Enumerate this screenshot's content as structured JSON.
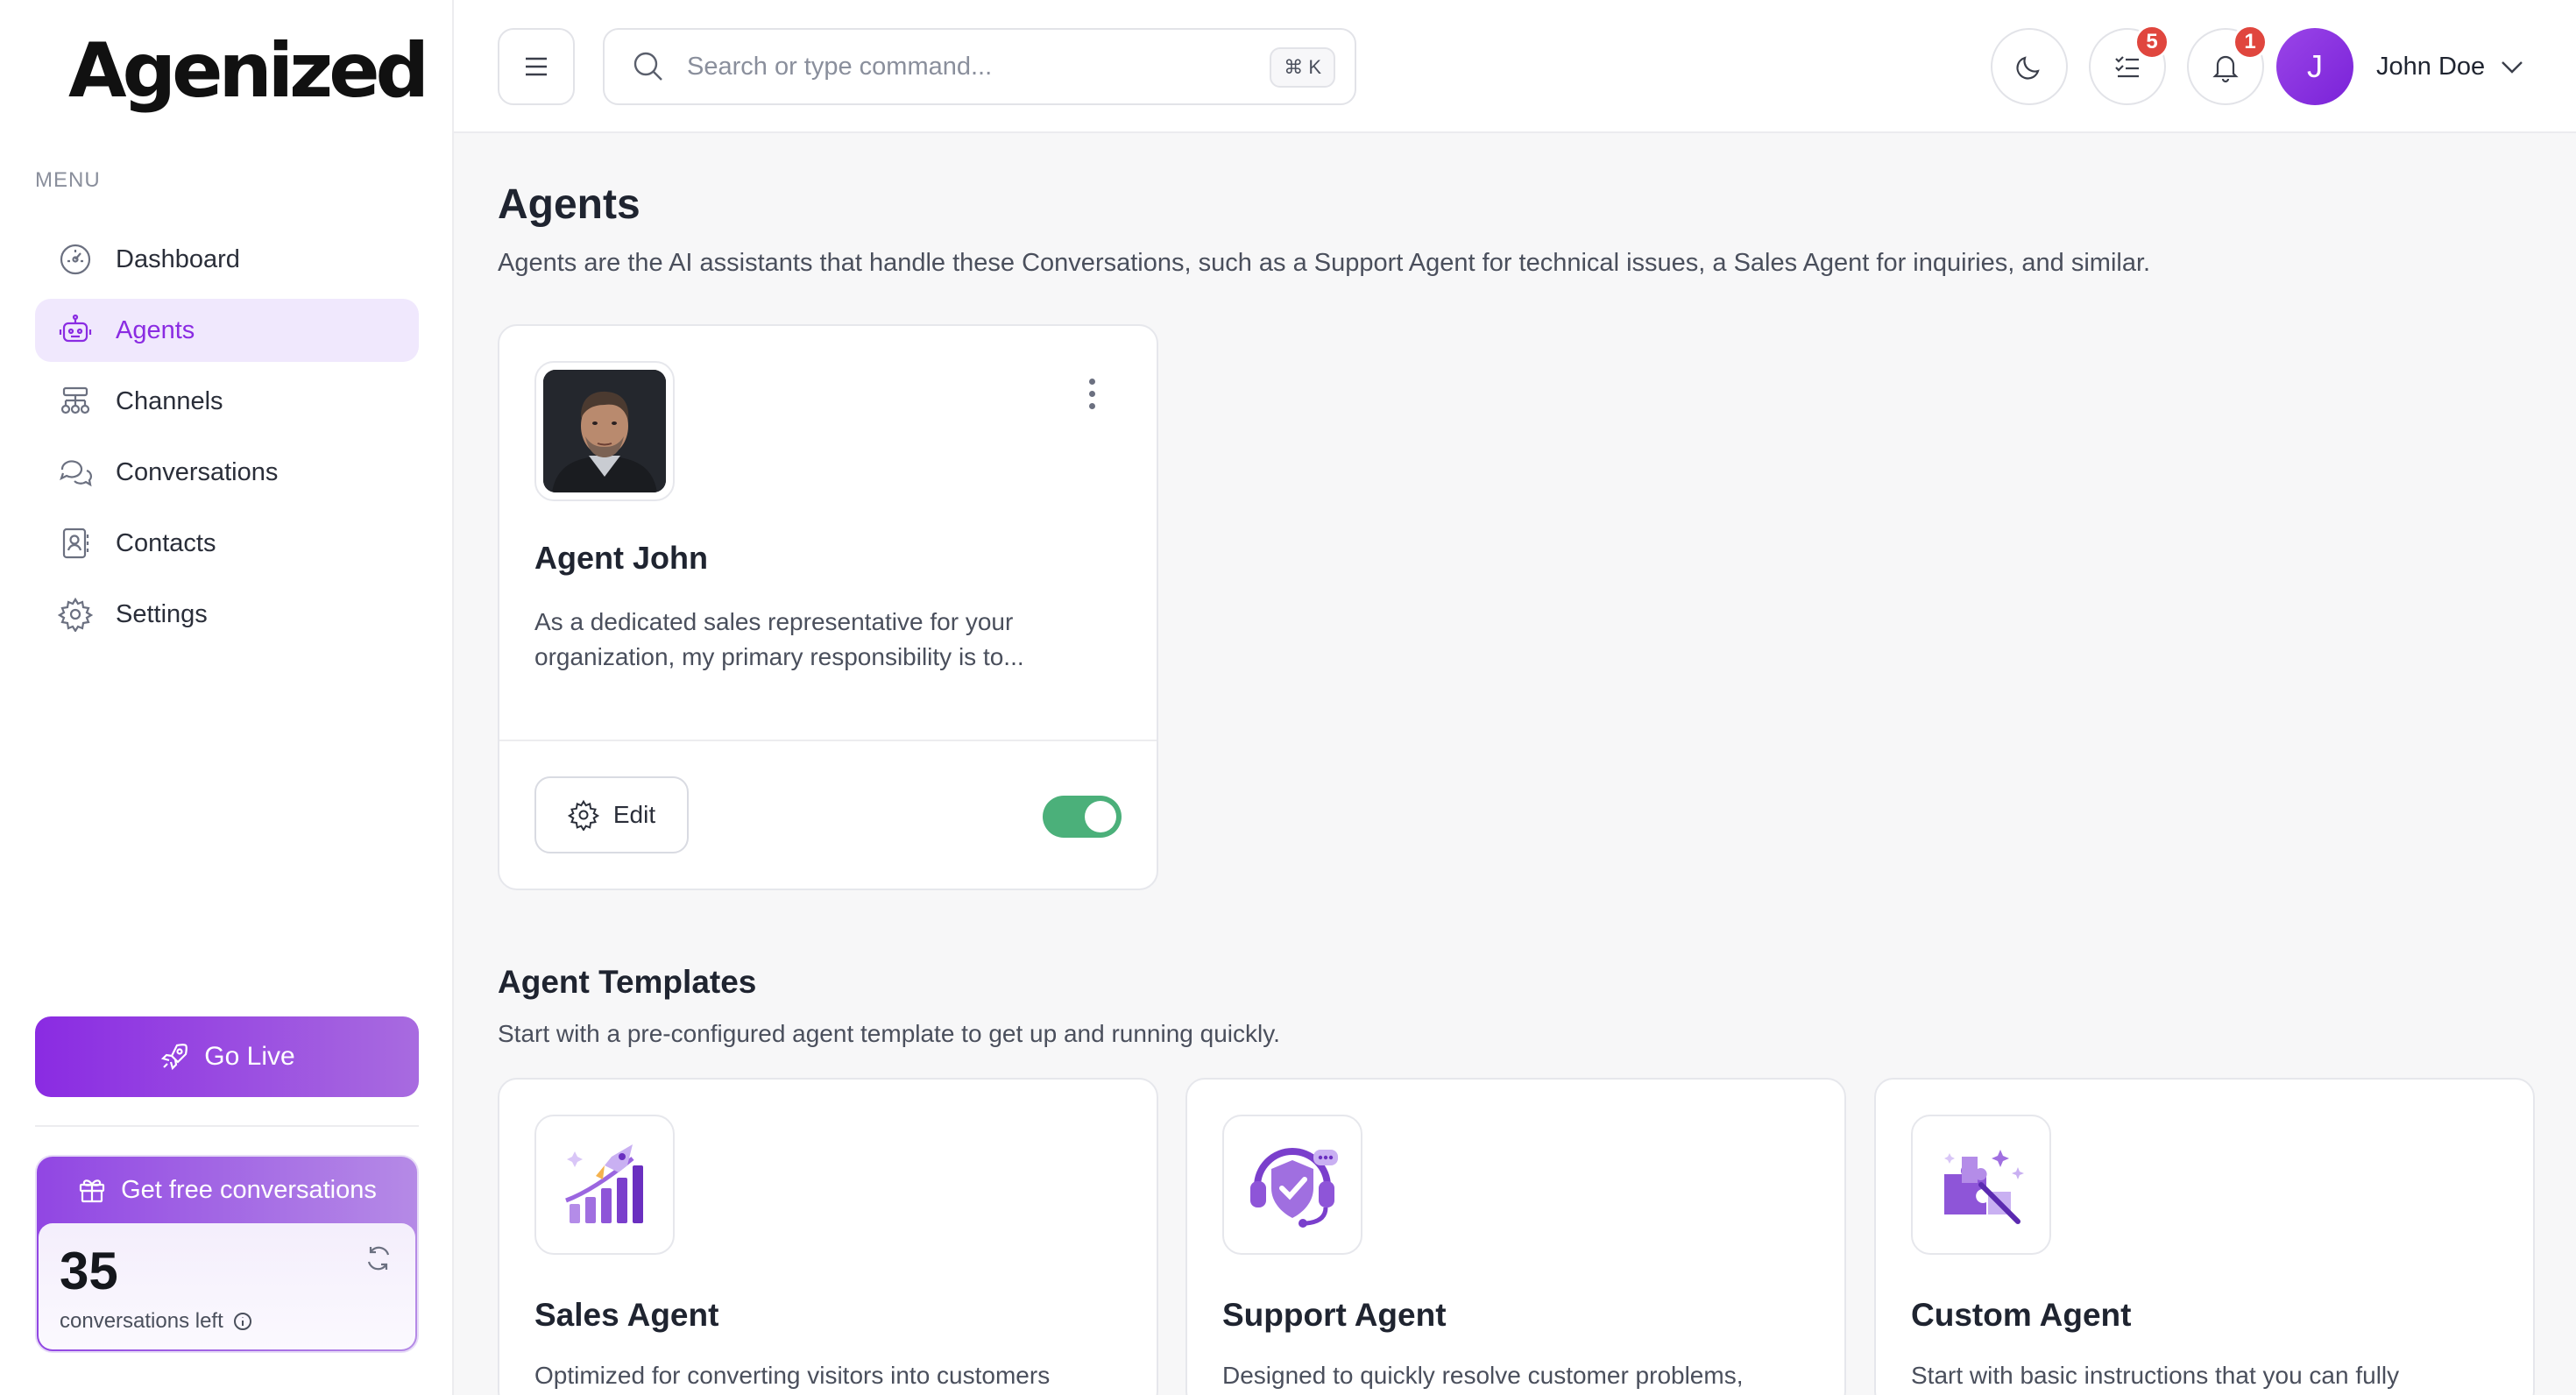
{
  "brand": {
    "logo_text": "Agenized"
  },
  "sidebar": {
    "menu_label": "MENU",
    "items": [
      {
        "label": "Dashboard",
        "icon": "gauge-icon",
        "active": false
      },
      {
        "label": "Agents",
        "icon": "robot-icon",
        "active": true
      },
      {
        "label": "Channels",
        "icon": "channels-icon",
        "active": false
      },
      {
        "label": "Conversations",
        "icon": "chat-bubbles-icon",
        "active": false
      },
      {
        "label": "Contacts",
        "icon": "contact-book-icon",
        "active": false
      },
      {
        "label": "Settings",
        "icon": "gear-icon",
        "active": false
      }
    ],
    "go_live_label": "Go Live",
    "free_conversations": {
      "title": "Get free conversations",
      "count": "35",
      "subtitle": "conversations left"
    }
  },
  "topbar": {
    "search_placeholder": "Search or type command...",
    "search_shortcut": "⌘ K",
    "tasks_badge": "5",
    "notifications_badge": "1",
    "user": {
      "initial": "J",
      "name": "John Doe"
    }
  },
  "page": {
    "title": "Agents",
    "description": "Agents are the AI assistants that handle these Conversations, such as a Support Agent for technical issues, a Sales Agent for inquiries, and similar."
  },
  "agents": [
    {
      "name": "Agent John",
      "description": "As a dedicated sales representative for your organization, my primary responsibility is to...",
      "edit_label": "Edit",
      "enabled": true
    }
  ],
  "templates_section": {
    "title": "Agent Templates",
    "description": "Start with a pre-configured agent template to get up and running quickly.",
    "templates": [
      {
        "name": "Sales Agent",
        "description": "Optimized for converting visitors into customers",
        "icon": "rocket-chart-icon"
      },
      {
        "name": "Support Agent",
        "description": "Designed to quickly resolve customer problems,",
        "icon": "headset-shield-icon"
      },
      {
        "name": "Custom Agent",
        "description": "Start with basic instructions that you can fully",
        "icon": "puzzle-wand-icon"
      }
    ]
  },
  "colors": {
    "accent": "#8a2be2",
    "accent_light": "#f0e8fd",
    "toggle_on": "#4bb07a",
    "badge": "#e0463e"
  }
}
